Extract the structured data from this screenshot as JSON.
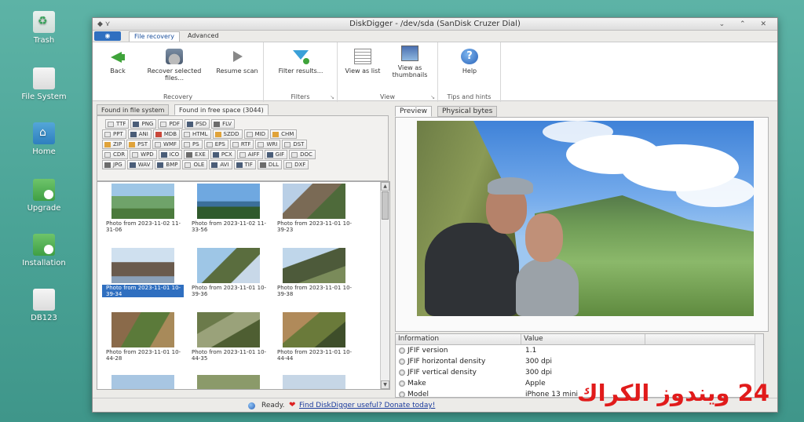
{
  "desktop": {
    "icons": [
      {
        "label": "Trash",
        "icon": "trash-icon"
      },
      {
        "label": "File System",
        "icon": "drive-icon"
      },
      {
        "label": "Home",
        "icon": "home-folder-icon"
      },
      {
        "label": "Upgrade",
        "icon": "upgrade-icon"
      },
      {
        "label": "Installation",
        "icon": "install-icon"
      },
      {
        "label": "DB123",
        "icon": "drive-icon"
      }
    ]
  },
  "window": {
    "title": "DiskDigger - /dev/sda (SanDisk Cruzer Dial)",
    "titlebar_left": "◆ ⋎",
    "titlebar_right": "⌄ ⌃ ✕"
  },
  "ribbon": {
    "app_button": "◉",
    "tabs": [
      "File recovery",
      "Advanced"
    ],
    "groups": {
      "recovery": {
        "label": "Recovery",
        "back": "Back",
        "recover": "Recover selected files...",
        "resume": "Resume scan"
      },
      "filters": {
        "label": "Filters",
        "filter": "Filter results..."
      },
      "view": {
        "label": "View",
        "list": "View as list",
        "thumbs": "View as thumbnails"
      },
      "tips": {
        "label": "Tips and hints",
        "help": "Help"
      }
    },
    "group_corner": "↘"
  },
  "left_pane": {
    "tabs": [
      "Found in file system",
      "Found in free space (3044)"
    ],
    "file_types": [
      [
        "TTF",
        "PNG",
        "PDF",
        "PSD",
        "FLV"
      ],
      [
        "PPT",
        "ANI",
        "MDB",
        "HTML",
        "SZDD",
        "MID",
        "CHM"
      ],
      [
        "ZIP",
        "PST",
        "WMF",
        "PS",
        "EPS",
        "RTF",
        "WRI",
        "DST"
      ],
      [
        "CDR",
        "WPD",
        "ICO",
        "EXE",
        "PCX",
        "AIFF",
        "GIF",
        "DOC"
      ],
      [
        "JPG",
        "WAV",
        "BMP",
        "OLE",
        "AVI",
        "TIF",
        "DLL",
        "DXF"
      ]
    ],
    "thumbnails": [
      {
        "caption": "Photo from 2023-11-02 11-31-06"
      },
      {
        "caption": "Photo from 2023-11-02 11-33-56"
      },
      {
        "caption": "Photo from 2023-11-01 10-39-23"
      },
      {
        "caption": "Photo from 2023-11-01 10-39-34",
        "selected": true
      },
      {
        "caption": "Photo from 2023-11-01 10-39-36"
      },
      {
        "caption": "Photo from 2023-11-01 10-39-38"
      },
      {
        "caption": "Photo from 2023-11-01 10-44-28"
      },
      {
        "caption": "Photo from 2023-11-01 10-44-35"
      },
      {
        "caption": "Photo from 2023-11-01 10-44-44"
      },
      {
        "caption": ""
      },
      {
        "caption": ""
      },
      {
        "caption": ""
      }
    ],
    "scroll_up": "▲",
    "scroll_down": "▼"
  },
  "right_pane": {
    "tabs": [
      "Preview",
      "Physical bytes"
    ],
    "info": {
      "headers": [
        "Information",
        "Value"
      ],
      "rows": [
        {
          "key": "JFIF version",
          "value": "1.1"
        },
        {
          "key": "JFIF horizontal density",
          "value": "300 dpi"
        },
        {
          "key": "JFIF vertical density",
          "value": "300 dpi"
        },
        {
          "key": "Make",
          "value": "Apple"
        },
        {
          "key": "Model",
          "value": "iPhone 13 mini"
        }
      ]
    }
  },
  "status": {
    "text": "Ready.",
    "heart": "❤",
    "donate": "Find DiskDigger useful? Donate today!"
  },
  "watermark": "24 ويندوز الكراك"
}
